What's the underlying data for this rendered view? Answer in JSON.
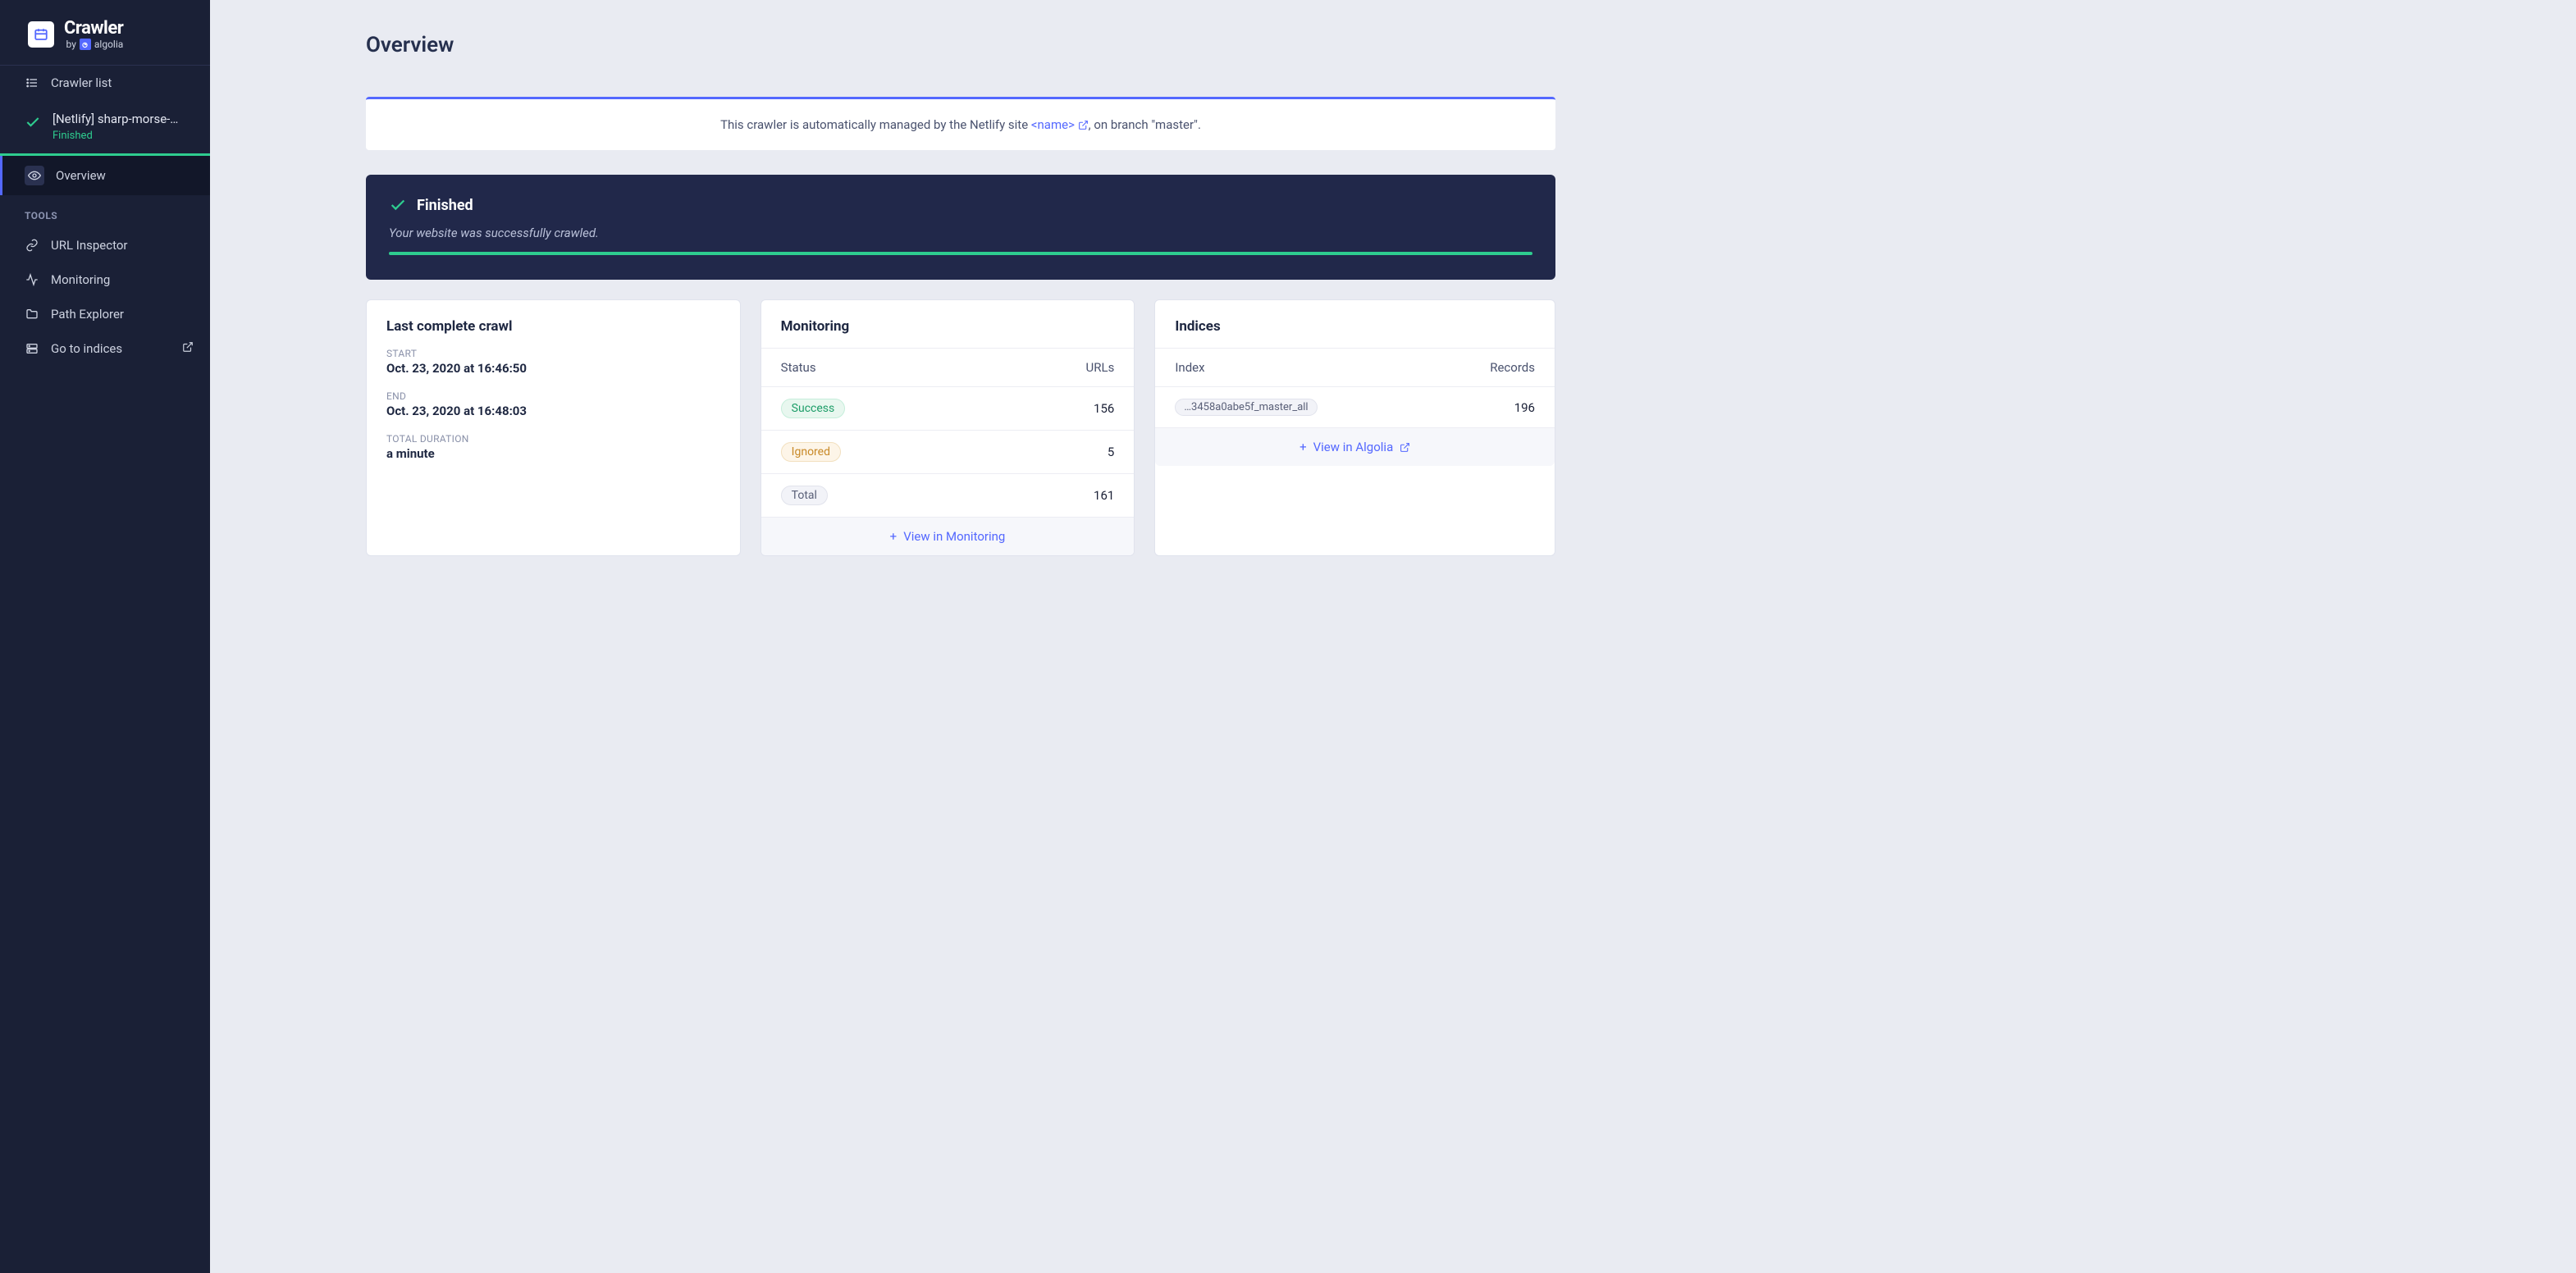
{
  "logo": {
    "brand": "Crawler",
    "by": "by",
    "algolia": "algolia"
  },
  "sidebar": {
    "crawler_list": "Crawler list",
    "current": {
      "name": "[Netlify] sharp-morse-…",
      "status": "Finished"
    },
    "overview": "Overview",
    "tools_header": "TOOLS",
    "url_inspector": "URL Inspector",
    "monitoring": "Monitoring",
    "path_explorer": "Path Explorer",
    "go_to_indices": "Go to indices"
  },
  "page": {
    "title": "Overview"
  },
  "banner": {
    "pre": "This crawler is automatically managed by the Netlify site ",
    "link": "<name>",
    "post": ", on branch \"master\"."
  },
  "status": {
    "title": "Finished",
    "message": "Your website was successfully crawled."
  },
  "last_crawl": {
    "title": "Last complete crawl",
    "start_label": "START",
    "start_value": "Oct. 23, 2020 at 16:46:50",
    "end_label": "END",
    "end_value": "Oct. 23, 2020 at 16:48:03",
    "duration_label": "TOTAL DURATION",
    "duration_value": "a minute"
  },
  "monitoring": {
    "title": "Monitoring",
    "col_status": "Status",
    "col_urls": "URLs",
    "rows": [
      {
        "label": "Success",
        "kind": "success",
        "count": "156"
      },
      {
        "label": "Ignored",
        "kind": "ignored",
        "count": "5"
      },
      {
        "label": "Total",
        "kind": "total",
        "count": "161"
      }
    ],
    "footer": "View in Monitoring"
  },
  "indices": {
    "title": "Indices",
    "col_index": "Index",
    "col_records": "Records",
    "rows": [
      {
        "name": "…3458a0abe5f_master_all",
        "records": "196"
      }
    ],
    "footer": "View in Algolia"
  }
}
